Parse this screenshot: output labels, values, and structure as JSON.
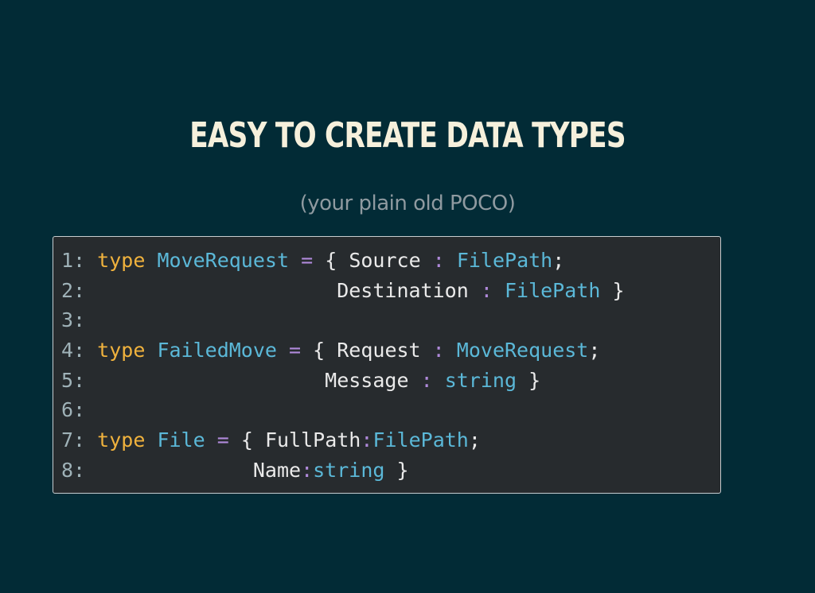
{
  "slide": {
    "title": "EASY TO CREATE DATA TYPES",
    "subtitle": "(your plain old POCO)"
  },
  "code": {
    "lines": [
      {
        "number": "1:",
        "keyword": "type",
        "space1": " ",
        "type_name": "MoveRequest",
        "space2": " ",
        "equals": "=",
        "open": " { ",
        "field1": "Source",
        "sep1a": " ",
        "colon1": ":",
        "sep1b": " ",
        "type1": "FilePath",
        "end1": ";"
      },
      {
        "number": "2:",
        "indent": "                    ",
        "field": "Destination",
        "sep_a": " ",
        "colon": ":",
        "sep_b": " ",
        "type": "FilePath",
        "end": " }"
      },
      {
        "number": "3:"
      },
      {
        "number": "4:",
        "keyword": "type",
        "space1": " ",
        "type_name": "FailedMove",
        "space2": " ",
        "equals": "=",
        "open": " { ",
        "field1": "Request",
        "sep1a": " ",
        "colon1": ":",
        "sep1b": " ",
        "type1": "MoveRequest",
        "end1": ";"
      },
      {
        "number": "5:",
        "indent": "                   ",
        "field": "Message",
        "sep_a": " ",
        "colon": ":",
        "sep_b": " ",
        "type": "string",
        "end": " }"
      },
      {
        "number": "6:"
      },
      {
        "number": "7:",
        "keyword": "type",
        "space1": " ",
        "type_name": "File",
        "space2": " ",
        "equals": "=",
        "open": " { ",
        "field1": "FullPath",
        "colon1": ":",
        "type1": "FilePath",
        "end1": ";"
      },
      {
        "number": "8:",
        "indent": "             ",
        "field": "Name",
        "colon": ":",
        "type": "string",
        "end": " }"
      }
    ]
  },
  "colors": {
    "background": "#002b36",
    "title": "#f6f0dc",
    "subtitle": "#8f9aa0",
    "code_background": "#272b2e",
    "keyword": "#f0b23d",
    "type_name": "#5bb8d8",
    "operator": "#b08adb",
    "line_number": "#9fb2b8"
  }
}
